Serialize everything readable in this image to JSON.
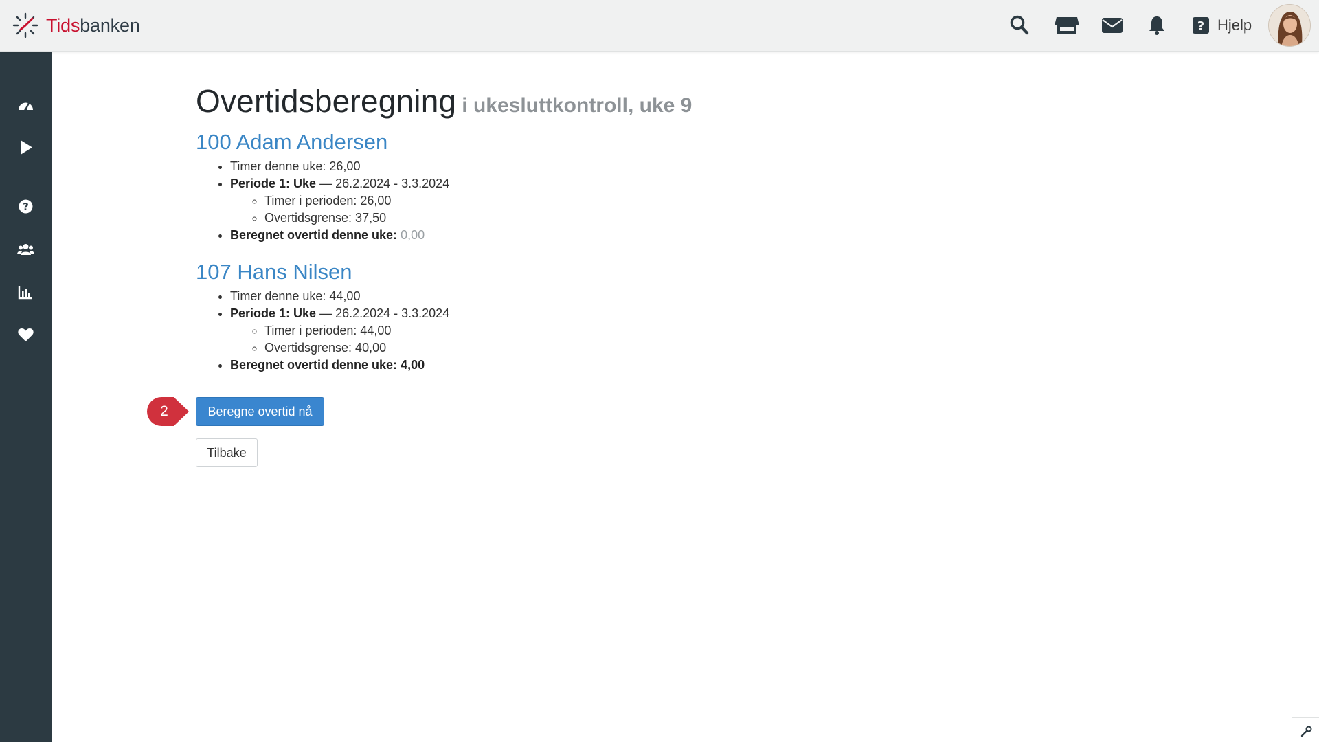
{
  "brand": {
    "name_part1": "Tids",
    "name_part2": "banken",
    "accent": "#c8102e",
    "dark": "#2f3c46"
  },
  "topbar": {
    "icons": [
      "search-icon",
      "store-icon",
      "mail-icon",
      "bell-icon"
    ],
    "help_label": "Hjelp"
  },
  "sidebar": {
    "items": [
      "dashboard-icon",
      "play-icon",
      "help-icon",
      "users-icon",
      "chart-icon",
      "heart-icon"
    ]
  },
  "page": {
    "title": "Overtidsberegning",
    "subtitle": "i ukesluttkontroll, uke 9"
  },
  "employees": [
    {
      "name": "100 Adam Andersen",
      "hours_week": "Timer denne uke: 26,00",
      "period_label": "Periode 1: Uke",
      "period_range": " — 26.2.2024 - 3.3.2024",
      "hours_period": "Timer i perioden: 26,00",
      "overtime_limit": "Overtidsgrense: 37,50",
      "calc_label": "Beregnet overtid denne uke:",
      "calc_value": "0,00"
    },
    {
      "name": "107 Hans Nilsen",
      "hours_week": "Timer denne uke: 44,00",
      "period_label": "Periode 1: Uke",
      "period_range": " — 26.2.2024 - 3.3.2024",
      "hours_period": "Timer i perioden: 44,00",
      "overtime_limit": "Overtidsgrense: 40,00",
      "calc_label": "Beregnet overtid denne uke:",
      "calc_value": "4,00"
    }
  ],
  "buttons": {
    "calculate": "Beregne overtid nå",
    "back": "Tilbake"
  },
  "step_badge": "2",
  "colors": {
    "primary": "#3a86cf",
    "sidebar": "#2c3a42",
    "badge": "#d0313d",
    "link": "#3a86c5"
  }
}
